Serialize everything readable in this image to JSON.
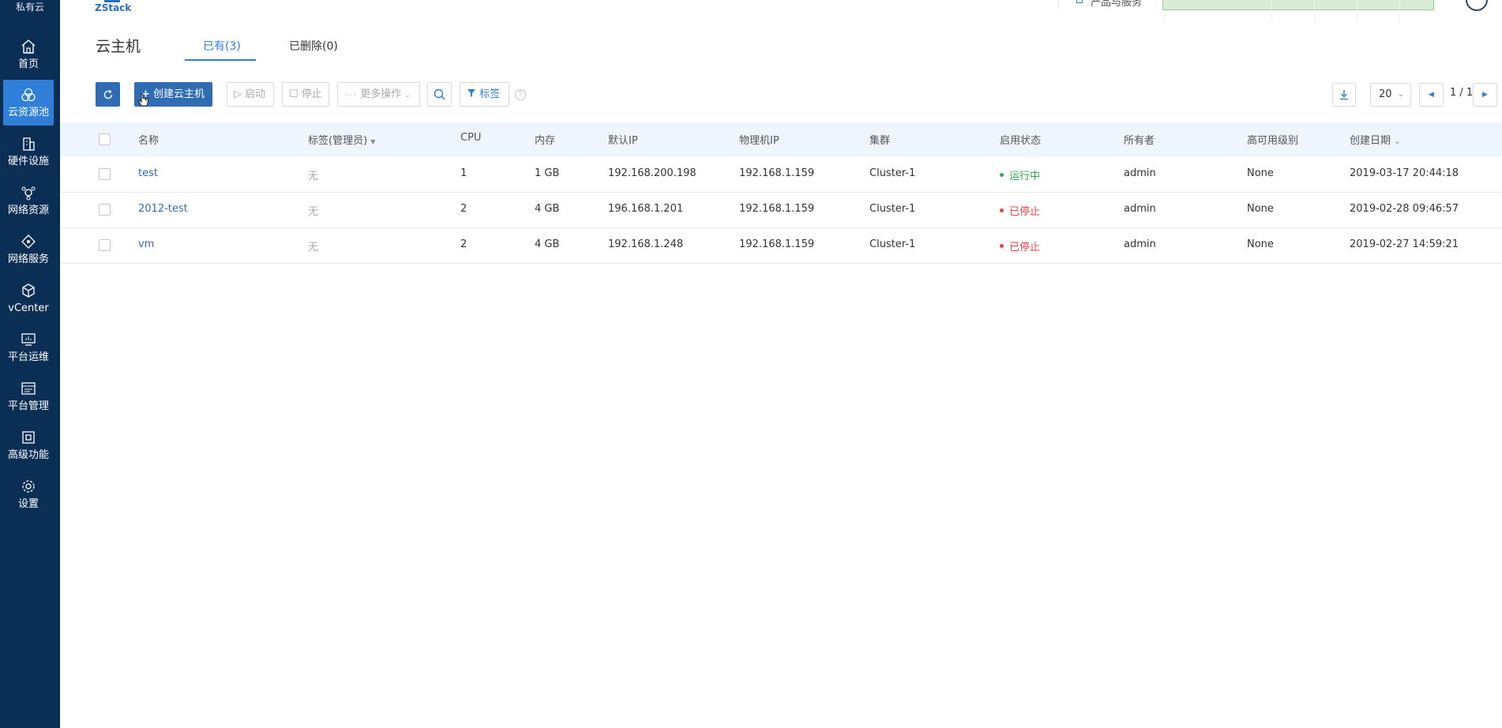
{
  "sidebar": {
    "top_label": "私有云",
    "items": [
      {
        "label": "首页",
        "icon": "home-icon"
      },
      {
        "label": "云资源池",
        "icon": "cloud-pool-icon",
        "active": true
      },
      {
        "label": "硬件设施",
        "icon": "building-icon"
      },
      {
        "label": "网络资源",
        "icon": "network-icon"
      },
      {
        "label": "网络服务",
        "icon": "network-service-icon"
      },
      {
        "label": "vCenter",
        "icon": "cube-icon"
      },
      {
        "label": "平台运维",
        "icon": "monitor-icon"
      },
      {
        "label": "平台管理",
        "icon": "list-icon"
      },
      {
        "label": "高级功能",
        "icon": "advanced-icon"
      },
      {
        "label": "设置",
        "icon": "gear-icon"
      }
    ]
  },
  "brand": {
    "logo_text": "ZStack"
  },
  "topbar": {
    "service_label": "产品与服务"
  },
  "page": {
    "title": "云主机",
    "tabs": [
      {
        "label": "已有(3)",
        "active": true
      },
      {
        "label": "已删除(0)",
        "active": false
      }
    ]
  },
  "toolbar": {
    "create_label": "创建云主机",
    "start_label": "启动",
    "stop_label": "停止",
    "more_label": "更多操作",
    "tag_label": "标签",
    "help_label": "?",
    "page_size": "20",
    "page_indicator": "1 / 1"
  },
  "table": {
    "columns": [
      "名称",
      "标签(管理员)",
      "CPU",
      "内存",
      "默认IP",
      "物理机IP",
      "集群",
      "启用状态",
      "所有者",
      "高可用级别",
      "创建日期"
    ],
    "rows": [
      {
        "name": "test",
        "tag": "无",
        "cpu": "1",
        "memory": "1 GB",
        "ip": "192.168.200.198",
        "host_ip": "192.168.1.159",
        "cluster": "Cluster-1",
        "status": "运行中",
        "status_color": "#2faa4c",
        "owner": "admin",
        "ha": "None",
        "created": "2019-03-17 20:44:18"
      },
      {
        "name": "2012-test",
        "tag": "无",
        "cpu": "2",
        "memory": "4 GB",
        "ip": "196.168.1.201",
        "host_ip": "192.168.1.159",
        "cluster": "Cluster-1",
        "status": "已停止",
        "status_color": "#e8424a",
        "owner": "admin",
        "ha": "None",
        "created": "2019-02-28 09:46:57"
      },
      {
        "name": "vm",
        "tag": "无",
        "cpu": "2",
        "memory": "4 GB",
        "ip": "192.168.1.248",
        "host_ip": "192.168.1.159",
        "cluster": "Cluster-1",
        "status": "已停止",
        "status_color": "#e8424a",
        "owner": "admin",
        "ha": "None",
        "created": "2019-02-27 14:59:21"
      }
    ]
  },
  "colors": {
    "sidebar": "#0b2f54",
    "accent": "#2f7ed8",
    "primary_button": "#2f6cb3",
    "running": "#2faa4c",
    "stopped": "#e8424a"
  }
}
